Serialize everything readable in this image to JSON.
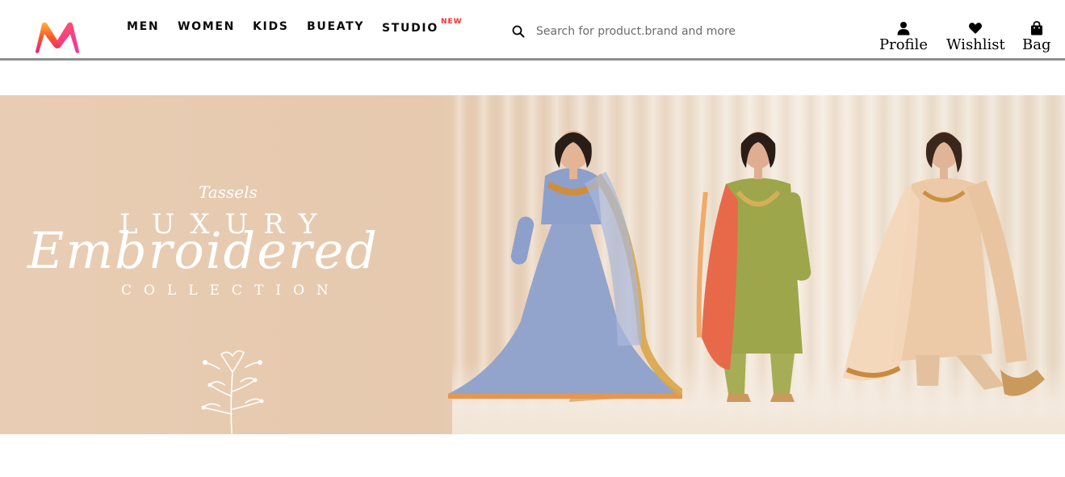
{
  "header": {
    "logo_icon": "myntra-m-logo",
    "nav": {
      "men": "MEN",
      "women": "WOMEN",
      "kids": "KIDS",
      "beauty": "BUEATY",
      "studio": "STUDIO",
      "studio_badge": "NEW"
    },
    "search": {
      "icon": "search-icon",
      "placeholder": "Search for product.brand and more"
    },
    "actions": {
      "profile": {
        "icon": "user-icon",
        "label": "Profile"
      },
      "wishlist": {
        "icon": "heart-icon",
        "label": "Wishlist"
      },
      "bag": {
        "icon": "bag-icon",
        "label": "Bag"
      }
    }
  },
  "banner": {
    "brand": "Tassels",
    "line1": "LUXURY",
    "line2": "Embroidered",
    "line3": "COLLECTION"
  },
  "colors": {
    "nav_text": "#0b0b0b",
    "new_badge": "#ff2b2b",
    "header_border": "#8e8e8e",
    "banner_bg": "#e8cdb4",
    "logo_top": "#f97c23",
    "logo_bottom": "#e5226b"
  }
}
